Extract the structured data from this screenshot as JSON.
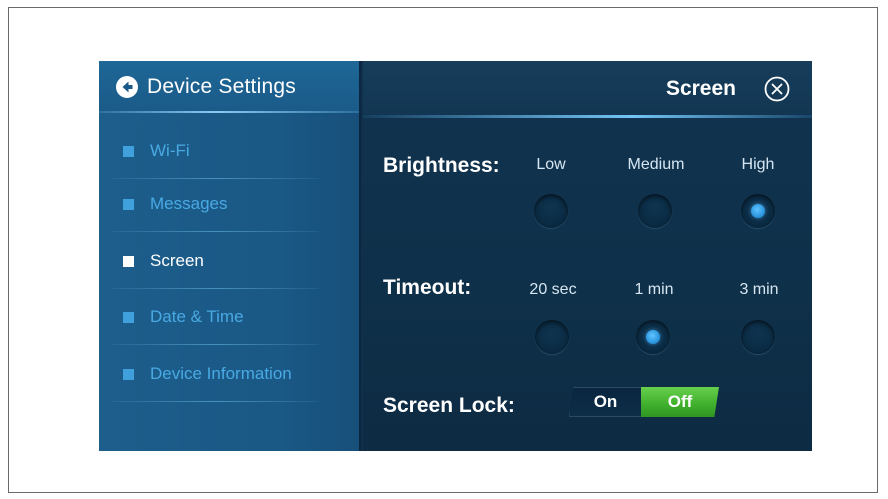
{
  "sidebar": {
    "title": "Device Settings",
    "items": [
      {
        "label": "Wi-Fi",
        "active": false
      },
      {
        "label": "Messages",
        "active": false
      },
      {
        "label": "Screen",
        "active": true
      },
      {
        "label": "Date & Time",
        "active": false
      },
      {
        "label": "Device Information",
        "active": false
      }
    ]
  },
  "main": {
    "title": "Screen",
    "brightness": {
      "label": "Brightness:",
      "options": [
        "Low",
        "Medium",
        "High"
      ],
      "selected": "High"
    },
    "timeout": {
      "label": "Timeout:",
      "options": [
        "20 sec",
        "1 min",
        "3 min"
      ],
      "selected": "1 min"
    },
    "screen_lock": {
      "label": "Screen Lock:",
      "on_label": "On",
      "off_label": "Off",
      "value": "Off"
    }
  },
  "colors": {
    "sidebar_bg": "#1a5a88",
    "main_bg": "#0f3049",
    "accent": "#2d97df",
    "toggle_green": "#3fae2c",
    "inactive_text": "#49a9e3"
  },
  "icons": {
    "back": "back-arrow-circle-icon",
    "close": "close-circle-x-icon",
    "bullet": "square-bullet-icon"
  }
}
